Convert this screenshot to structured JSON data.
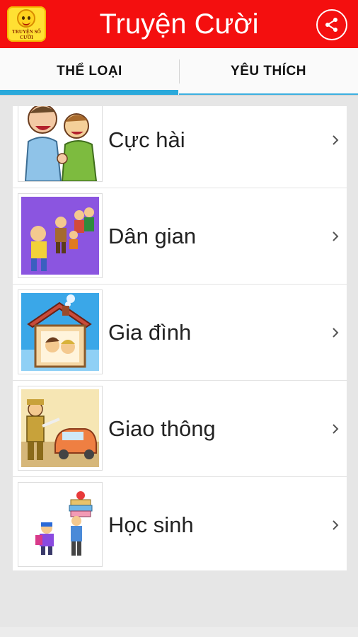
{
  "app": {
    "title": "Truyện Cười",
    "logo_text": "TRUYỆN SỐ CƯỜI",
    "share_icon": "share-icon",
    "accent": "#f40f0f"
  },
  "tabs": [
    {
      "label": "THỂ LOẠI",
      "selected": true
    },
    {
      "label": "YÊU THÍCH",
      "selected": false
    }
  ],
  "tab_indicator_color": "#2aa9db",
  "categories": [
    {
      "label": "Cực hài",
      "thumb": "laughing-men-thumbnail",
      "chevron": "chevron-right-icon"
    },
    {
      "label": "Dân gian",
      "thumb": "folk-village-thumbnail",
      "chevron": "chevron-right-icon"
    },
    {
      "label": "Gia đình",
      "thumb": "family-house-thumbnail",
      "chevron": "chevron-right-icon"
    },
    {
      "label": "Giao thông",
      "thumb": "traffic-police-thumbnail",
      "chevron": "chevron-right-icon"
    },
    {
      "label": "Học sinh",
      "thumb": "students-thumbnail",
      "chevron": "chevron-right-icon"
    }
  ]
}
